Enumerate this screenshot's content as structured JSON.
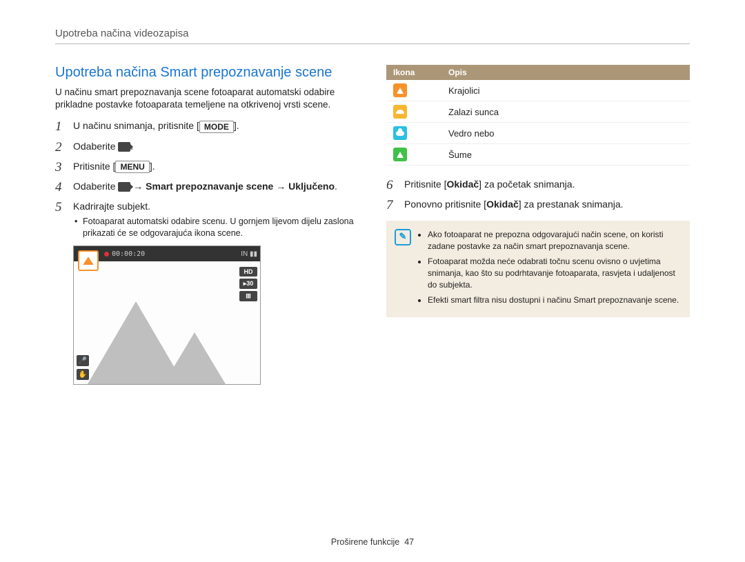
{
  "header": {
    "title": "Upotreba načina videozapisa"
  },
  "main": {
    "heading": "Upotreba načina Smart prepoznavanje scene",
    "intro": "U načinu smart prepoznavanja scene fotoaparat automatski odabire prikladne postavke fotoaparata temeljene na otkrivenoj vrsti scene.",
    "steps": {
      "s1a": "U načinu snimanja, pritisnite ",
      "s1b": ".",
      "s2a": "Odaberite ",
      "s2b": ".",
      "s3a": "Pritisnite ",
      "s3b": ".",
      "s4a": "Odaberite ",
      "s4b": " → ",
      "s4c": "Smart prepoznavanje scene",
      "s4d": " → ",
      "s4e": "Uključeno",
      "s4f": ".",
      "s5": "Kadrirajte subjekt.",
      "s5_bullet": "Fotoaparat automatski odabire scenu. U gornjem lijevom dijelu zaslona prikazati će se odgovarajuća ikona scene."
    },
    "mode_btn": "MODE",
    "menu_btn": "MENU",
    "screen": {
      "timecode": "00:00:20",
      "battery": "IN ▮▮",
      "hd": "HD",
      "fps": "▸30",
      "grid": "⊞"
    }
  },
  "right": {
    "table": {
      "h1": "Ikona",
      "h2": "Opis",
      "rows": [
        {
          "label": "Krajolici"
        },
        {
          "label": "Zalazi sunca"
        },
        {
          "label": "Vedro nebo"
        },
        {
          "label": "Šume"
        }
      ]
    },
    "steps": {
      "s6a": "Pritisnite [",
      "s6b": "Okidač",
      "s6c": "] za početak snimanja.",
      "s7a": "Ponovno pritisnite [",
      "s7b": "Okidač",
      "s7c": "] za prestanak snimanja."
    },
    "notes": [
      "Ako fotoaparat ne prepozna odgovarajući način scene, on koristi zadane postavke za način smart prepoznavanja scene.",
      "Fotoaparat možda neće odabrati točnu scenu ovisno o uvjetima snimanja, kao što su podrhtavanje fotoaparata, rasvjeta i udaljenost do subjekta.",
      "Efekti smart filtra nisu dostupni i načinu Smart prepoznavanje scene."
    ]
  },
  "footer": {
    "section": "Proširene funkcije",
    "page": "47"
  }
}
